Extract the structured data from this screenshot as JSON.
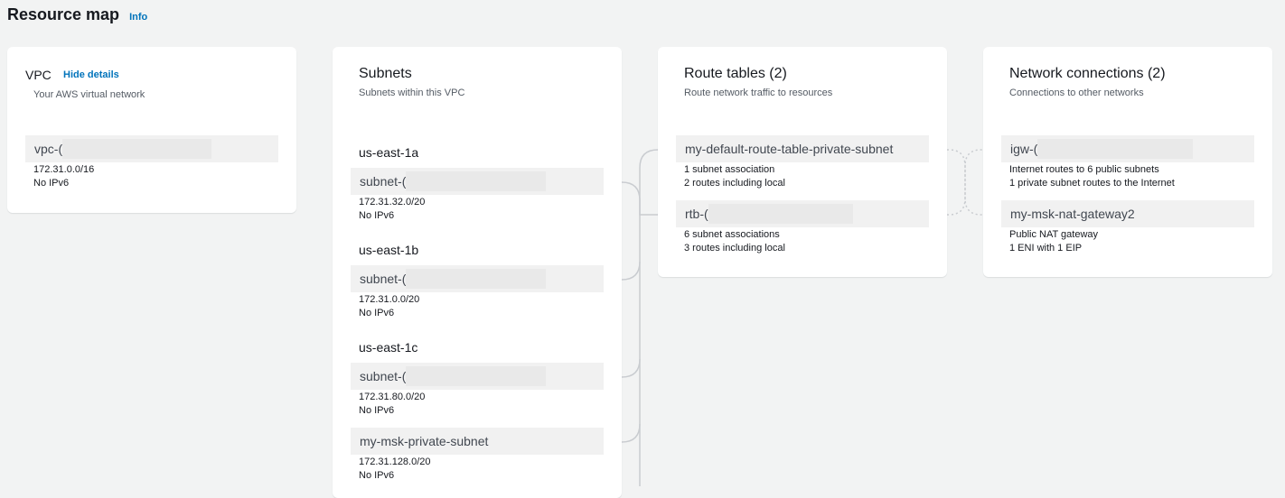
{
  "header": {
    "title": "Resource map",
    "info_label": "Info"
  },
  "vpc": {
    "title": "VPC",
    "hide_details_label": "Hide details",
    "description": "Your AWS virtual network",
    "resource": {
      "id": "vpc-(",
      "cidr": "172.31.0.0/16",
      "ipv6": "No IPv6"
    }
  },
  "subnets": {
    "title": "Subnets",
    "description": "Subnets within this VPC",
    "groups": [
      {
        "az": "us-east-1a",
        "items": [
          {
            "id": "subnet-(",
            "cidr": "172.31.32.0/20",
            "ipv6": "No IPv6"
          }
        ]
      },
      {
        "az": "us-east-1b",
        "items": [
          {
            "id": "subnet-(",
            "cidr": "172.31.0.0/20",
            "ipv6": "No IPv6"
          }
        ]
      },
      {
        "az": "us-east-1c",
        "items": [
          {
            "id": "subnet-(",
            "cidr": "172.31.80.0/20",
            "ipv6": "No IPv6"
          },
          {
            "id": "my-msk-private-subnet",
            "cidr": "172.31.128.0/20",
            "ipv6": "No IPv6"
          }
        ]
      }
    ]
  },
  "route_tables": {
    "title": "Route tables (2)",
    "description": "Route network traffic to resources",
    "items": [
      {
        "name": "my-default-route-table-private-subnet",
        "line1": "1 subnet association",
        "line2": "2 routes including local"
      },
      {
        "name": "rtb-(",
        "line1": "6 subnet associations",
        "line2": "3 routes including local"
      }
    ]
  },
  "network_connections": {
    "title": "Network connections (2)",
    "description": "Connections to other networks",
    "items": [
      {
        "name": "igw-(",
        "line1": "Internet routes to 6 public subnets",
        "line2": "1 private subnet routes to the Internet"
      },
      {
        "name": "my-msk-nat-gateway2",
        "line1": "Public NAT gateway",
        "line2": "1 ENI with 1 EIP"
      }
    ]
  },
  "colors": {
    "link": "#0073bb",
    "background": "#f2f3f3",
    "panel": "#ffffff",
    "resource_bg": "#f1f1f1",
    "connector": "#c9ccd0"
  }
}
